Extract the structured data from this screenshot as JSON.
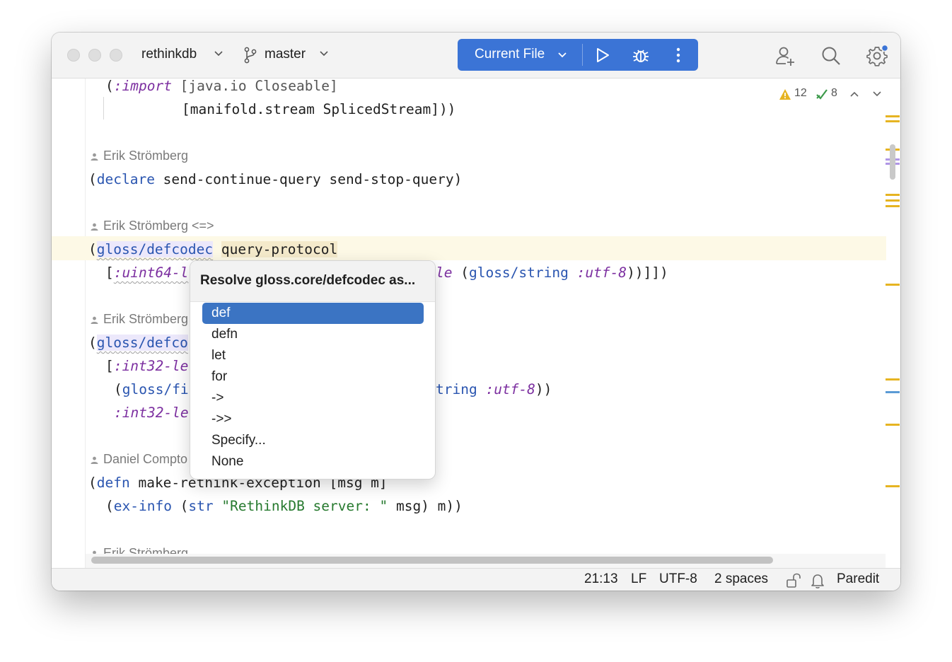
{
  "titlebar": {
    "project": "rethinkdb",
    "branch": "master",
    "run_config": "Current File"
  },
  "inspections": {
    "warnings": "12",
    "ok": "8"
  },
  "editor": {
    "authors": {
      "a1": "Erik Strömberg",
      "a2": "Erik Strömberg <=>",
      "a3": "Erik Strömberg",
      "a4": "Daniel Compto",
      "a5": "Erik Strömberg"
    },
    "code": {
      "l1_open": "(",
      "l1_kw": ":import",
      "l1_rest": " [java.io Closeable]",
      "l2": "[manifold.stream SplicedStream]))",
      "l3_open": "(",
      "l3_kw": "declare",
      "l3_rest": " send-continue-query send-stop-query)",
      "l4_open": "(",
      "l4_kw": "gloss/defcodec",
      "l4_sp": " ",
      "l4_name": "query-protocol",
      "l5_open": "[",
      "l5_kw": ":uint64-l",
      "l5_tail_kw": "le",
      "l5_tail_rest": " (",
      "l5_tail_fn": "gloss/string",
      "l5_tail_sp": " ",
      "l5_tail_kw2": ":utf-8",
      "l5_tail_close": "))]])",
      "l6_open": "(",
      "l6_kw": "gloss/defco",
      "l7_open": "[",
      "l7_kw": ":int32-le",
      "l8_open": "(",
      "l8_kw": "gloss/fi",
      "l8_tail_kw": "tring",
      "l8_tail_sp": " ",
      "l8_tail_kw2": ":utf-8",
      "l8_tail_close": "))",
      "l9_kw": ":int32-le",
      "l10_open": "(",
      "l10_kw": "defn",
      "l10_rest": " make-rethink-exception [msg m]",
      "l11_open": "(",
      "l11_fn": "ex-info",
      "l11_a": " (",
      "l11_fn2": "str",
      "l11_sp": " ",
      "l11_str": "\"RethinkDB server: \"",
      "l11_rest": " msg) m))"
    }
  },
  "popup": {
    "title": "Resolve gloss.core/defcodec as...",
    "items": [
      "def",
      "defn",
      "let",
      "for",
      "->",
      "->>",
      "Specify...",
      "None"
    ],
    "selected": "def"
  },
  "statusbar": {
    "position": "21:13",
    "line_sep": "LF",
    "encoding": "UTF-8",
    "indent": "2 spaces",
    "mode": "Paredit"
  },
  "colors": {
    "accent": "#3b74d6",
    "selection": "#3b74c3",
    "warning": "#e6b422",
    "keyword": "#2a55b0",
    "keyword_italic": "#7c2fa0",
    "string": "#277a2f"
  },
  "icons": [
    "branch-icon",
    "run-icon",
    "debug-icon",
    "more-icon",
    "add-user-icon",
    "search-icon",
    "settings-icon",
    "warning-icon",
    "check-icon",
    "lock-icon",
    "bell-icon",
    "person-icon"
  ]
}
